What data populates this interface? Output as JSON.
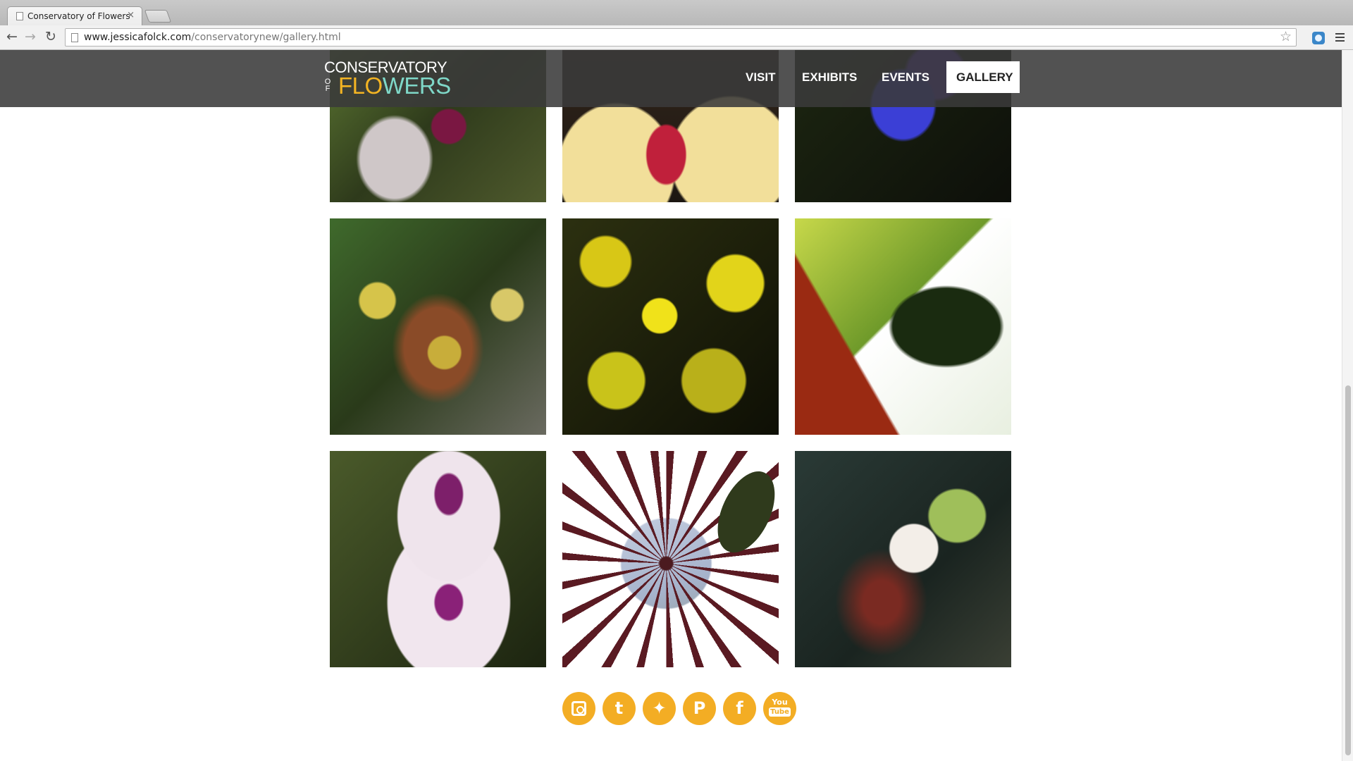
{
  "browser": {
    "tab_title": "Conservatory of Flowers",
    "tab_close": "×",
    "url_domain": "www.jessicafolck.com",
    "url_path": "/conservatorynew/gallery.html",
    "back_glyph": "←",
    "forward_glyph": "→",
    "reload_glyph": "↻",
    "star_glyph": "☆"
  },
  "site": {
    "logo_top": "CONSERVATORY",
    "logo_of": "OF",
    "logo_flo": "FLO",
    "logo_wers": "WERS",
    "nav": [
      {
        "label": "VISIT"
      },
      {
        "label": "EXHIBITS"
      },
      {
        "label": "EVENTS"
      },
      {
        "label": "GALLERY",
        "active": true
      }
    ]
  },
  "gallery": {
    "photos": [
      {
        "subject": "magenta slipper orchid"
      },
      {
        "subject": "cream orchid with red lip"
      },
      {
        "subject": "blue iris petal"
      },
      {
        "subject": "tiger-striped orchids"
      },
      {
        "subject": "yellow oncidium orchids"
      },
      {
        "subject": "heliconia bird of paradise"
      },
      {
        "subject": "white-pink phalaenopsis orchids"
      },
      {
        "subject": "hoya starburst flower cluster"
      },
      {
        "subject": "white trailing flower"
      }
    ]
  },
  "social": {
    "icons": [
      "instagram-icon",
      "tumblr-icon",
      "twitter-icon",
      "pinterest-icon",
      "facebook-icon",
      "youtube-icon"
    ],
    "tumblr_glyph": "t",
    "twitter_glyph": "✦",
    "pinterest_glyph": "P",
    "facebook_glyph": "f",
    "youtube_top": "You",
    "youtube_bottom": "Tube"
  },
  "colors": {
    "header_bg": "#3a3a3a",
    "logo_orange": "#f3b423",
    "logo_teal": "#7fd8c8",
    "social_orange": "#f3ad24"
  }
}
